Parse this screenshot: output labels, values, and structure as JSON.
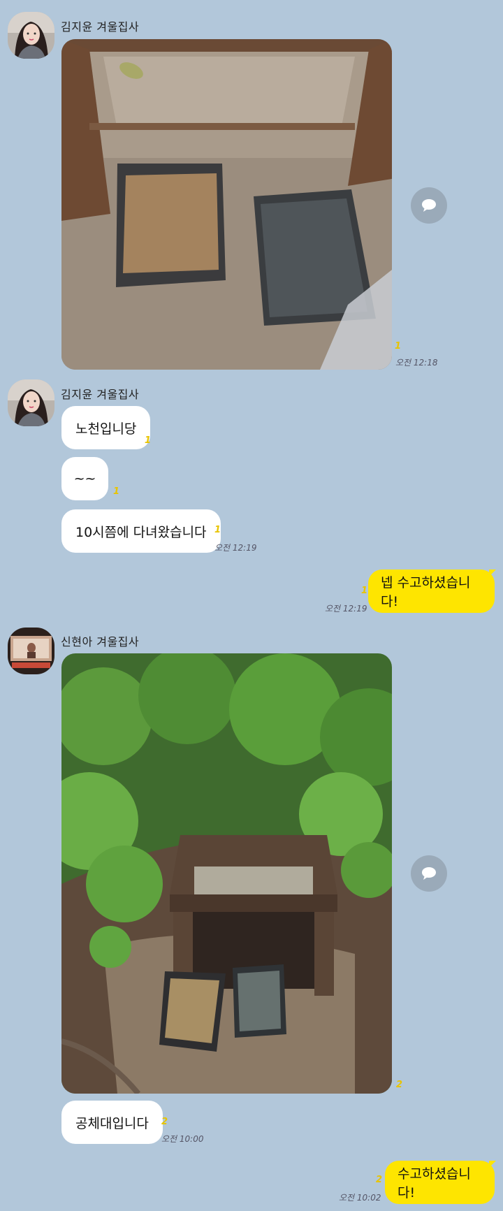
{
  "messages": [
    {
      "sender": "김지윤 겨울집사",
      "type": "photo",
      "unread": "1",
      "time": "오전 12:18"
    },
    {
      "sender": "김지윤 겨울집사",
      "type": "text",
      "items": [
        {
          "text": "노천입니당",
          "unread": "1"
        },
        {
          "text": "~~",
          "unread": "1"
        },
        {
          "text": "10시쯤에 다녀왔습니다",
          "unread": "1",
          "time": "오전 12:19"
        }
      ]
    },
    {
      "sender": "me",
      "type": "text",
      "text": "넵 수고하셨습니다!",
      "unread": "1",
      "time": "오전 12:19"
    },
    {
      "sender": "신현아 겨울집사",
      "type": "photo",
      "unread": "2"
    },
    {
      "sender": "신현아 겨울집사",
      "type": "text",
      "text": "공체대입니다",
      "unread": "2",
      "time": "오전 10:00"
    },
    {
      "sender": "me",
      "type": "text",
      "text": "수고하셨습니다!",
      "unread": "2",
      "time": "오전 10:02"
    }
  ],
  "colors": {
    "background": "#b2c7da",
    "incoming": "#ffffff",
    "outgoing": "#fee500",
    "unread": "#e8c400"
  },
  "icons": {
    "share": "speech-bubble-icon"
  }
}
